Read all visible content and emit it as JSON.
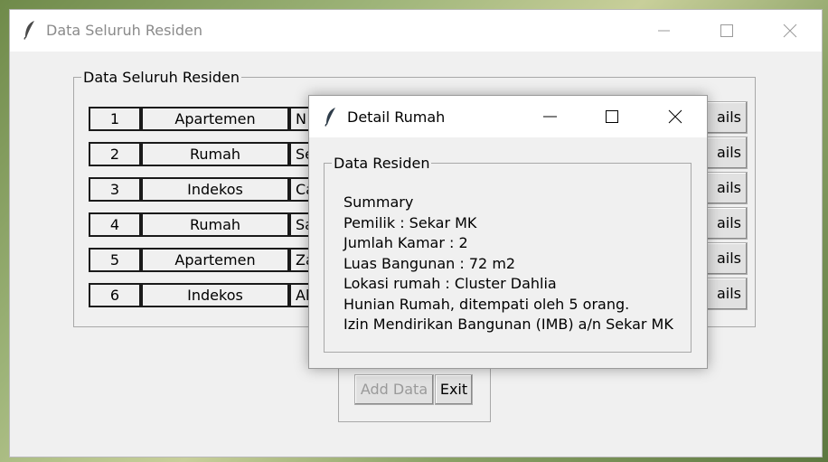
{
  "main_window": {
    "title": "Data Seluruh Residen",
    "group_label": "Data Seluruh Residen",
    "rows": [
      {
        "no": "1",
        "type": "Apartemen",
        "name": "N",
        "details": "ails"
      },
      {
        "no": "2",
        "type": "Rumah",
        "name": "Se",
        "details": "ails"
      },
      {
        "no": "3",
        "type": "Indekos",
        "name": "Ca",
        "details": "ails"
      },
      {
        "no": "4",
        "type": "Rumah",
        "name": "Sa",
        "details": "ails"
      },
      {
        "no": "5",
        "type": "Apartemen",
        "name": "Za",
        "details": "ails"
      },
      {
        "no": "6",
        "type": "Indekos",
        "name": "Al",
        "details": "ails"
      }
    ],
    "add_button": "Add Data",
    "exit_button": "Exit"
  },
  "detail_window": {
    "title": "Detail Rumah",
    "group_label": "Data Residen",
    "lines": [
      "Summary",
      "Pemilik : Sekar MK",
      "Jumlah Kamar : 2",
      "Luas Bangunan : 72 m2",
      "Lokasi rumah : Cluster Dahlia",
      "Hunian Rumah, ditempati oleh 5 orang.",
      "Izin Mendirikan Bangunan (IMB) a/n Sekar MK"
    ]
  },
  "icons": {
    "app": "feather-icon",
    "minimize": "minimize-icon",
    "maximize": "maximize-icon",
    "close": "close-icon"
  }
}
